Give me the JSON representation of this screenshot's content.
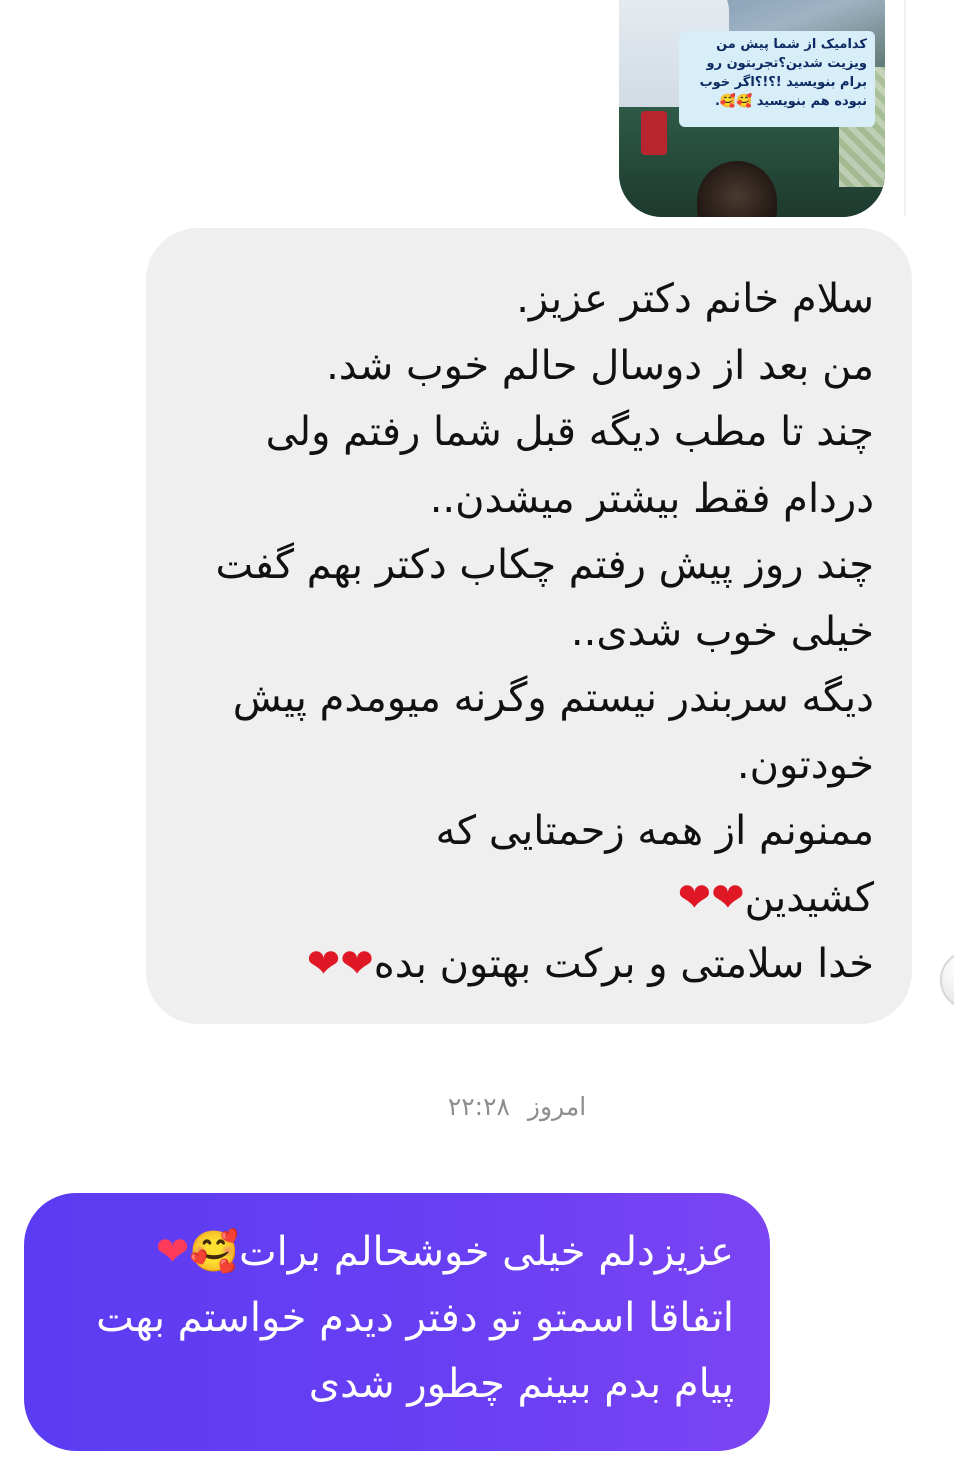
{
  "story_reply": {
    "caption": "کدامیک از شما پیش من\nویزیت شدین؟تجربتون رو\nبرام بنویسید !؟!؟اگر خوب\nنبوده هم بنویسید 🥰🥰."
  },
  "messages": {
    "incoming": {
      "line1": "سلام خانم دکتر عزیز.",
      "line2": "من بعد از دوسال حالم خوب شد.",
      "line3": "چند تا مطب دیگه قبل شما رفتم ولی",
      "line4": "دردام فقط بیشتر میشدن..",
      "line5": "چند روز پیش رفتم چکاب دکتر بهم گفت",
      "line6": "خیلی خوب شدی..",
      "line7": "دیگه سربندر نیستم وگرنه میومدم پیش",
      "line8": "خودتون.",
      "line9": "ممنونم از همه زحمتایی که",
      "line10": "کشیدین",
      "line10_emoji": "❤❤",
      "line11": "خدا سلامتی و برکت بهتون بده",
      "line11_emoji": "❤❤"
    },
    "timestamp": {
      "day": "امروز",
      "time": "۲۲:۲۸"
    },
    "outgoing": {
      "line1": "عزیزدلم خیلی خوشحالم برات",
      "line1_emoji": "🥰❤",
      "line2": "اتفاقا اسمتو تو دفتر دیدم خواستم بهت",
      "line3": "پیام بدم ببینم چطور شدی"
    }
  },
  "colors": {
    "incoming_bubble": "#efefef",
    "outgoing_bubble": "#6a3ff3",
    "heart": "#e01825",
    "timestamp_text": "#8e8e8e"
  }
}
